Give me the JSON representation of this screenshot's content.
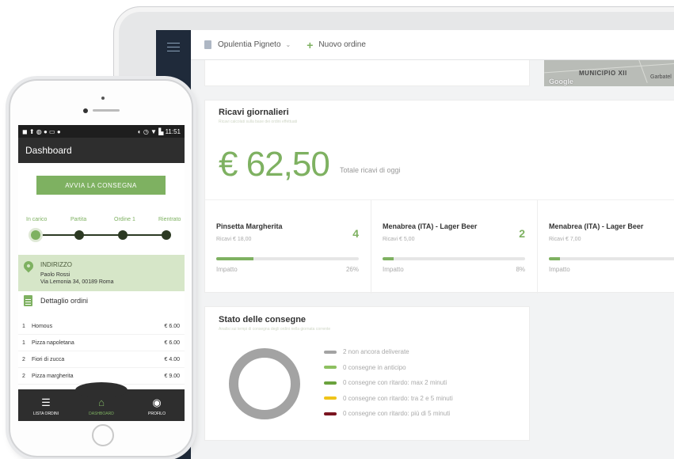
{
  "tablet": {
    "header": {
      "store_name": "Opulentia Pigneto",
      "new_order_label": "Nuovo ordine"
    },
    "map": {
      "municipio": "MUNICIPIO XII",
      "area": "Garbatel",
      "logo": "Google"
    },
    "revenue": {
      "title": "Ricavi giornalieri",
      "subtitle": "Ricavi calcolati sulla base dei ordini effettuati",
      "amount": "€ 62,50",
      "amount_caption": "Totale ricavi di oggi"
    },
    "kpis": [
      {
        "name": "Pinsetta Margherita",
        "revenue": "Ricavi € 18,00",
        "qty": "4",
        "impact_label": "Impatto",
        "impact": "26%",
        "impact_value": 26
      },
      {
        "name": "Menabrea (ITA) - Lager Beer",
        "revenue": "Ricavi € 5,00",
        "qty": "2",
        "impact_label": "Impatto",
        "impact": "8%",
        "impact_value": 8
      },
      {
        "name": "Menabrea (ITA) - Lager Beer",
        "revenue": "Ricavi € 7,00",
        "qty": "",
        "impact_label": "Impatto",
        "impact": "",
        "impact_value": 8
      }
    ],
    "delivery": {
      "title": "Stato delle consegne",
      "subtitle": "Analisi sui tempi di consegna degli ordini nella giornata corrente",
      "legend": [
        {
          "label": "2 non ancora deliverate",
          "color": "#a3a3a3"
        },
        {
          "label": "0 consegne in anticipo",
          "color": "#8dc060"
        },
        {
          "label": "0 consegne con ritardo: max 2 minuti",
          "color": "#6aa23d"
        },
        {
          "label": "0 consegne con ritardo: tra 2 e 5 minuti",
          "color": "#f0c419"
        },
        {
          "label": "0 consegne con ritardo: più di 5 minuti",
          "color": "#7a1420"
        }
      ]
    }
  },
  "phone": {
    "status": {
      "left": "◼ ⬆ ◍ ● ▭ ●",
      "right": "◐ ◷ ▼ ▙ 11:51"
    },
    "title": "Dashboard",
    "start_button": "AVVIA LA CONSEGNA",
    "steps": [
      "In carico",
      "Partita",
      "Ordine 1",
      "Rientrato"
    ],
    "address": {
      "title": "INDIRIZZO",
      "name": "Paolo Rossi",
      "street": "Via Lemonia 34, 00189 Roma"
    },
    "details_title": "Dettaglio ordini",
    "orders": [
      {
        "qty": "1",
        "name": "Homous",
        "price": "€ 6.00"
      },
      {
        "qty": "1",
        "name": "Pizza napoletana",
        "price": "€ 6.00"
      },
      {
        "qty": "2",
        "name": "Fiori di zucca",
        "price": "€ 4.00"
      },
      {
        "qty": "2",
        "name": "Pizza margherita",
        "price": "€ 9.00"
      }
    ],
    "nav": [
      {
        "label": "LISTA ORDINI",
        "icon": "list-icon"
      },
      {
        "label": "DASHBOARD",
        "icon": "home-icon"
      },
      {
        "label": "PROFILO",
        "icon": "profile-icon"
      }
    ]
  },
  "colors": {
    "accent": "#7eb161",
    "sidebar": "#1f2a3a",
    "phone_bar": "#2e2e2e"
  }
}
